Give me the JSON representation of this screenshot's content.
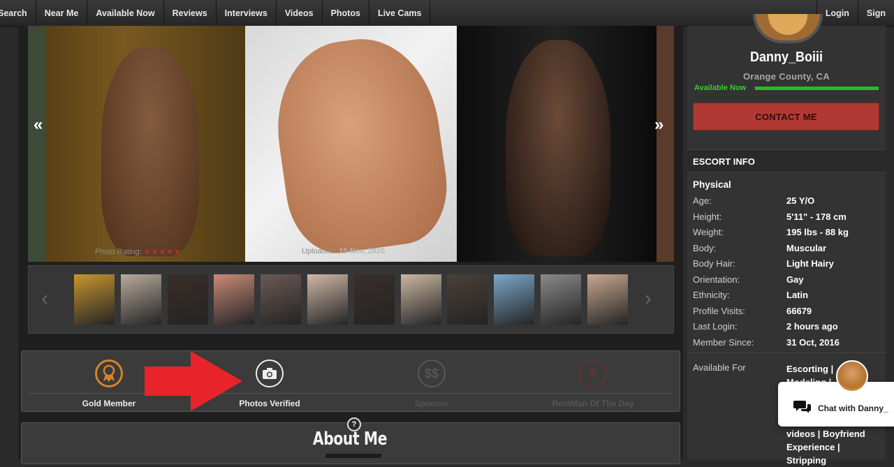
{
  "nav": {
    "items": [
      "Search",
      "Near Me",
      "Available Now",
      "Reviews",
      "Interviews",
      "Videos",
      "Photos",
      "Live Cams"
    ],
    "right": [
      "Login",
      "Sign"
    ]
  },
  "slider": {
    "prev": "«",
    "next": "»",
    "photo_rating_label": "Photo Rating:",
    "photo_rating_stars": "★★★★★",
    "uploaded_label": "Uploaded:",
    "uploaded_value": "15 Nov, 2020"
  },
  "thumbnails": {
    "prev": "‹",
    "next": "›",
    "colors": [
      "#c9962e",
      "#b8ab9c",
      "#3a2e28",
      "#c98a78",
      "#6b5a55",
      "#cfb8a6",
      "#3a2e2a",
      "#cbb7a2",
      "#4a4038",
      "#7aa8c8",
      "#8a8a8a",
      "#c9a890"
    ]
  },
  "badges": {
    "gold": "Gold Member",
    "photos": "Photos Verified",
    "sponsor": "Sponsor",
    "rentman": "RentMan Of The Day"
  },
  "about": {
    "title": "About Me",
    "help": "?"
  },
  "profile": {
    "name": "Danny_Boiii",
    "location": "Orange County, CA",
    "status": "Available Now",
    "contact": "CONTACT ME"
  },
  "info": {
    "heading": "ESCORT INFO",
    "section": "Physical",
    "rows": [
      {
        "k": "Age:",
        "v": "25 Y/O"
      },
      {
        "k": "Height:",
        "v": "5'11\" - 178 cm"
      },
      {
        "k": "Weight:",
        "v": "195 lbs - 88 kg"
      },
      {
        "k": "Body:",
        "v": "Muscular"
      },
      {
        "k": "Body Hair:",
        "v": "Light Hairy"
      },
      {
        "k": "Orientation:",
        "v": "Gay"
      },
      {
        "k": "Ethnicity:",
        "v": "Latin"
      },
      {
        "k": "Profile Visits:",
        "v": "66679"
      },
      {
        "k": "Last Login:",
        "v": "2 hours ago"
      },
      {
        "k": "Member Since:",
        "v": "31 Oct, 2016"
      }
    ],
    "available_for_label": "Available For",
    "available_for_top": "Escorting |\nModeling |",
    "available_for_bottom": "videos | Boyfriend\nExperience |\nStripping"
  },
  "chat": {
    "label": "Chat with Danny_"
  }
}
